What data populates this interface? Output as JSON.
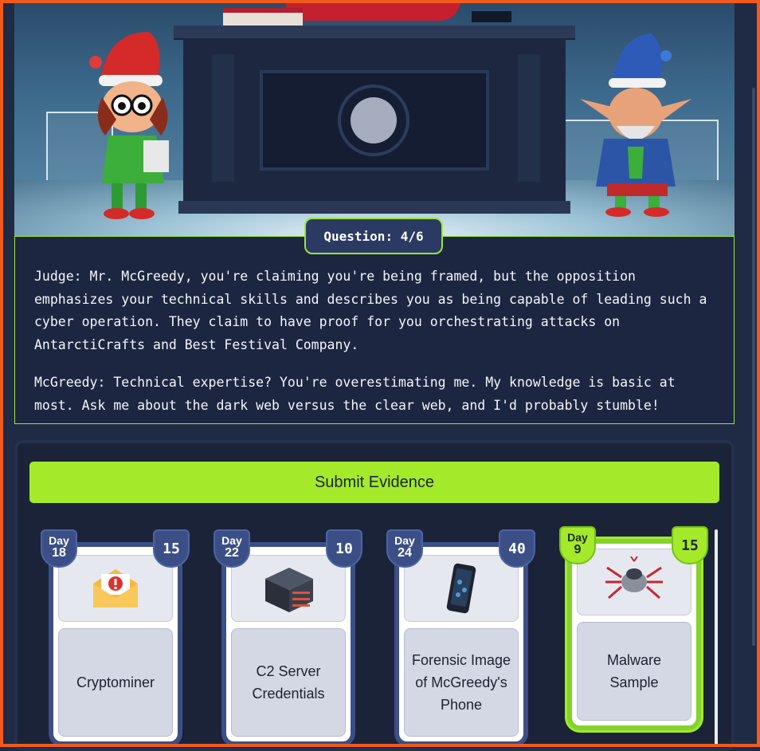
{
  "question": {
    "label": "Question: 4/6"
  },
  "dialogue": {
    "lines": [
      "Judge: Mr. McGreedy, you're claiming you're being framed, but the opposition emphasizes your technical skills and describes you as being capable of leading such a cyber operation. They claim to have proof for you orchestrating attacks on AntarctiCrafts and Best Festival Company.",
      "McGreedy: Technical expertise? You're overestimating me. My knowledge is basic at most. Ask me about the dark web versus the clear web, and I'd probably stumble!"
    ]
  },
  "submit": {
    "label": "Submit Evidence"
  },
  "evidence": [
    {
      "day_label": "Day",
      "day": "18",
      "score": "15",
      "title": "Cryptominer",
      "icon": "envelope-alert-icon",
      "selected": false
    },
    {
      "day_label": "Day",
      "day": "22",
      "score": "10",
      "title": "C2 Server Credentials",
      "icon": "server-icon",
      "selected": false
    },
    {
      "day_label": "Day",
      "day": "24",
      "score": "40",
      "title": "Forensic Image of McGreedy's Phone",
      "icon": "phone-icon",
      "selected": false
    },
    {
      "day_label": "Day",
      "day": "9",
      "score": "15",
      "title": "Malware Sample",
      "icon": "malware-bug-icon",
      "selected": true
    }
  ],
  "colors": {
    "accent": "#a4ea2a",
    "frame": "#f05a1a",
    "panel": "#1b2339",
    "card_border": "#3b4f86"
  }
}
